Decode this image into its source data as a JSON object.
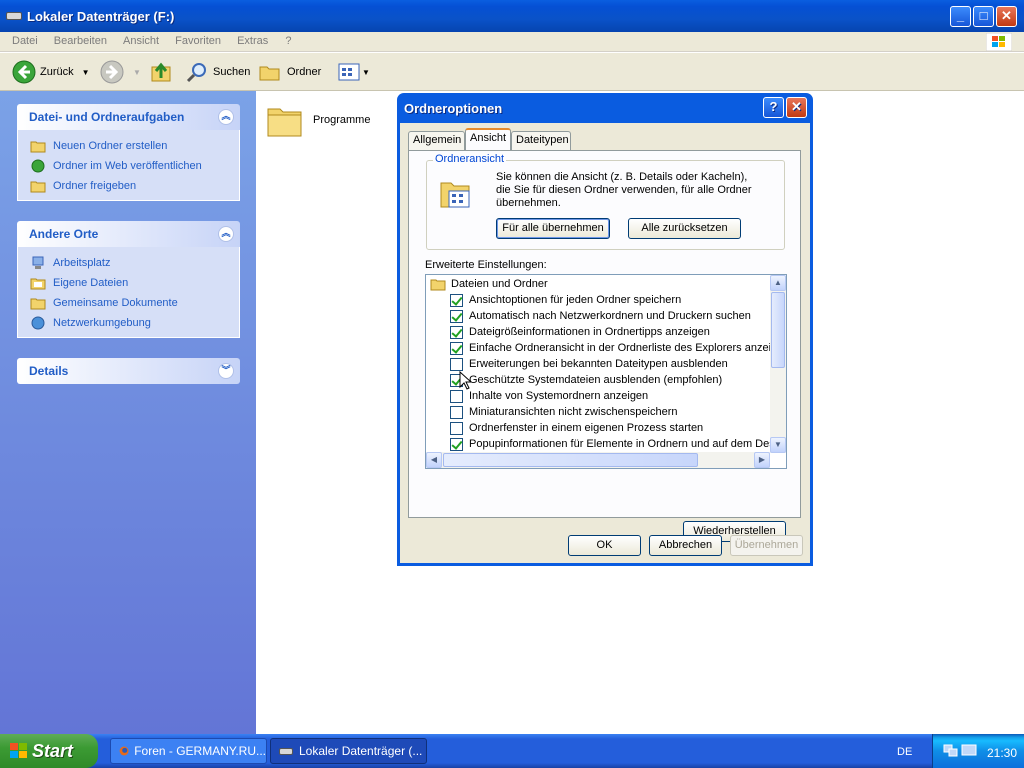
{
  "window": {
    "title": "Lokaler Datenträger (F:)",
    "min": "_",
    "max": "□",
    "close": "✕"
  },
  "menu": [
    "Datei",
    "Bearbeiten",
    "Ansicht",
    "Favoriten",
    "Extras",
    "?"
  ],
  "toolbar": {
    "back": "Zurück",
    "search": "Suchen",
    "folders": "Ordner"
  },
  "sidebar": {
    "tasks": {
      "title": "Datei- und Ordneraufgaben",
      "items": [
        "Neuen Ordner erstellen",
        "Ordner im Web veröffentlichen",
        "Ordner freigeben"
      ]
    },
    "places": {
      "title": "Andere Orte",
      "items": [
        "Arbeitsplatz",
        "Eigene Dateien",
        "Gemeinsame Dokumente",
        "Netzwerkumgebung"
      ]
    },
    "details": {
      "title": "Details"
    }
  },
  "content": {
    "folder": "Programme"
  },
  "dialog": {
    "title": "Ordneroptionen",
    "help": "?",
    "close": "✕",
    "tabs": [
      "Allgemein",
      "Ansicht",
      "Dateitypen"
    ],
    "group_label": "Ordneransicht",
    "group_text": [
      "Sie können die Ansicht (z. B. Details oder Kacheln),",
      "die Sie für diesen Ordner verwenden, für alle Ordner",
      "übernehmen."
    ],
    "apply_all": "Für alle übernehmen",
    "reset_all": "Alle zurücksetzen",
    "advanced_label": "Erweiterte Einstellungen:",
    "tree_root": "Dateien und Ordner",
    "settings": [
      {
        "label": "Ansichtoptionen für jeden Ordner speichern",
        "checked": true
      },
      {
        "label": "Automatisch nach Netzwerkordnern und Druckern suchen",
        "checked": true
      },
      {
        "label": "Dateigrößeinformationen in Ordnertipps anzeigen",
        "checked": true
      },
      {
        "label": "Einfache Ordneransicht in der Ordnerliste des Explorers anzeige",
        "checked": true
      },
      {
        "label": "Erweiterungen bei bekannten Dateitypen ausblenden",
        "checked": false
      },
      {
        "label": "Geschützte Systemdateien ausblenden (empfohlen)",
        "checked": true
      },
      {
        "label": "Inhalte von Systemordnern anzeigen",
        "checked": false
      },
      {
        "label": "Miniaturansichten nicht zwischenspeichern",
        "checked": false
      },
      {
        "label": "Ordnerfenster in einem eigenen Prozess starten",
        "checked": false
      },
      {
        "label": "Popupinformationen für Elemente in Ordnern und auf dem Desk",
        "checked": true
      }
    ],
    "restore": "Wiederherstellen",
    "ok": "OK",
    "cancel": "Abbrechen",
    "apply": "Übernehmen"
  },
  "taskbar": {
    "start": "Start",
    "tasks": [
      "Foren - GERMANY.RU...",
      "Lokaler Datenträger (..."
    ],
    "lang": "DE",
    "clock": "21:30"
  }
}
